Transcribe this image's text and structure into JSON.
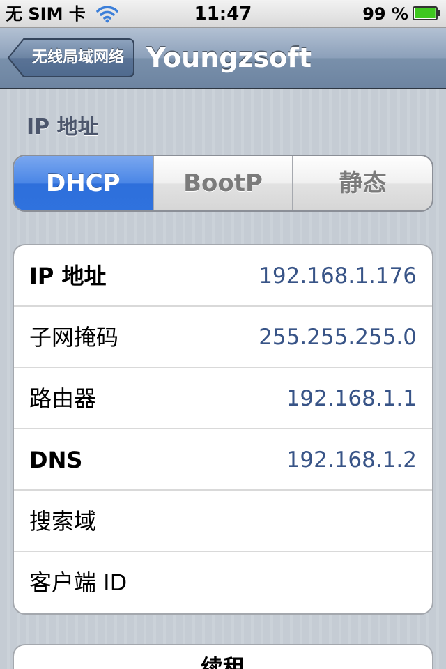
{
  "status_bar": {
    "carrier": "无 SIM 卡",
    "time": "11:47",
    "battery_percent": "99 %",
    "wifi_icon": "wifi-icon",
    "battery_icon": "battery-icon",
    "battery_level": 0.99,
    "battery_color": "#3ec71f"
  },
  "nav": {
    "back_label": "无线局域网络",
    "title": "Youngzsoft"
  },
  "section": {
    "header": "IP 地址"
  },
  "segments": {
    "items": [
      {
        "label": "DHCP",
        "selected": true
      },
      {
        "label": "BootP",
        "selected": false
      },
      {
        "label": "静态",
        "selected": false
      }
    ],
    "selected_color": "#3a7be0"
  },
  "table": {
    "rows": [
      {
        "label": "IP 地址",
        "value": "192.168.1.176"
      },
      {
        "label": "子网掩码",
        "value": "255.255.255.0"
      },
      {
        "label": "路由器",
        "value": "192.168.1.1"
      },
      {
        "label": "DNS",
        "value": "192.168.1.2"
      },
      {
        "label": "搜索域",
        "value": ""
      },
      {
        "label": "客户端 ID",
        "value": ""
      }
    ],
    "value_color": "#385487"
  },
  "renew": {
    "label": "续租"
  }
}
